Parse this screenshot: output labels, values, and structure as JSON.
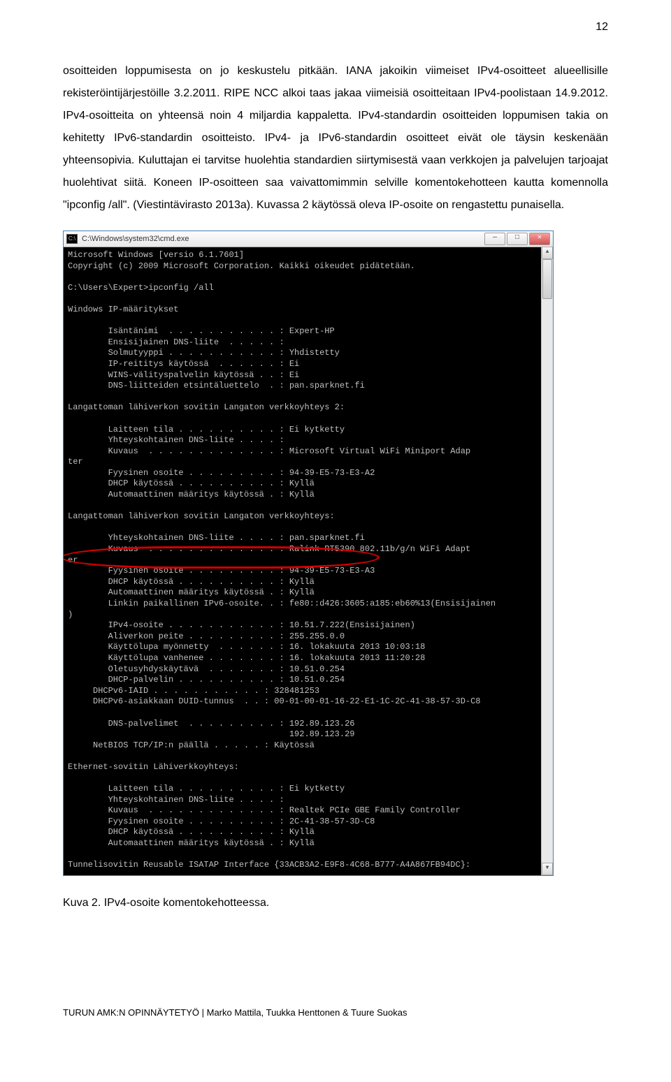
{
  "page_number": "12",
  "paragraph": "osoitteiden loppumisesta on jo keskustelu pitkään. IANA jakoikin viimeiset IPv4-osoitteet alueellisille rekisteröintijärjestöille 3.2.2011. RIPE NCC alkoi taas jakaa viimeisiä osoitteitaan IPv4-poolistaan 14.9.2012. IPv4-osoitteita on yhteensä noin 4 miljardia kappaletta. IPv4-standardin osoitteiden loppumisen takia on kehitetty IPv6-standardin osoitteisto. IPv4- ja IPv6-standardin osoitteet eivät ole täysin keskenään yhteensopivia. Kuluttajan ei tarvitse huolehtia standardien siirtymisestä vaan verkkojen ja palvelujen tarjoajat huolehtivat siitä. Koneen IP-osoitteen saa vaivattomimmin selville komentokehotteen kautta komennolla \"ipconfig /all\". (Viestintävirasto 2013a). Kuvassa 2 käytössä oleva IP-osoite on rengastettu punaisella.",
  "cmd": {
    "title": "C:\\Windows\\system32\\cmd.exe",
    "header1": "Microsoft Windows [versio 6.1.7601]",
    "header2": "Copyright (c) 2009 Microsoft Corporation. Kaikki oikeudet pidätetään.",
    "prompt": "C:\\Users\\Expert>ipconfig /all",
    "section_ip": "Windows IP-määritykset",
    "host_label": "        Isäntänimi  . . . . . . . . . . . : ",
    "host_val": "Expert-HP",
    "dns1_label": "        Ensisijainen DNS-liite  . . . . . :",
    "nodetype_label": "        Solmutyyppi . . . . . . . . . . . : ",
    "nodetype_val": "Yhdistetty",
    "iprouting_label": "        IP-reititys käytössä  . . . . . . : ",
    "iprouting_val": "Ei",
    "wins_label": "        WINS-välityspalvelin käytössä . . : ",
    "wins_val": "Ei",
    "dnssuffix_label": "        DNS-liitteiden etsintäluettelo  . : ",
    "dnssuffix_val": "pan.sparknet.fi",
    "adapter2_title": "Langattoman lähiverkon sovitin Langaton verkkoyhteys 2:",
    "a2_state_label": "        Laitteen tila . . . . . . . . . . : ",
    "a2_state_val": "Ei kytketty",
    "a2_dns_label": "        Yhteyskohtainen DNS-liite . . . . :",
    "a2_desc_label": "        Kuvaus  . . . . . . . . . . . . . : ",
    "a2_desc_val": "Microsoft Virtual WiFi Miniport Adap",
    "a2_cont": "ter",
    "a2_mac_label": "        Fyysinen osoite . . . . . . . . . : ",
    "a2_mac_val": "94-39-E5-73-E3-A2",
    "a2_dhcp_label": "        DHCP käytössä . . . . . . . . . . : ",
    "a2_dhcp_val": "Kyllä",
    "a2_auto_label": "        Automaattinen määritys käytössä . : ",
    "a2_auto_val": "Kyllä",
    "adapter1_title": "Langattoman lähiverkon sovitin Langaton verkkoyhteys:",
    "a1_dns_label": "        Yhteyskohtainen DNS-liite . . . . : ",
    "a1_dns_val": "pan.sparknet.fi",
    "a1_desc_label": "        Kuvaus  . . . . . . . . . . . . . : ",
    "a1_desc_val": "Ralink RT5390 802.11b/g/n WiFi Adapt",
    "a1_cont": "er",
    "a1_mac_label": "        Fyysinen osoite . . . . . . . . . : ",
    "a1_mac_val": "94-39-E5-73-E3-A3",
    "a1_dhcp_label": "        DHCP käytössä . . . . . . . . . . : ",
    "a1_dhcp_val": "Kyllä",
    "a1_auto_label": "        Automaattinen määritys käytössä . : ",
    "a1_auto_val": "Kyllä",
    "a1_ll_label": "        Linkin paikallinen IPv6-osoite. . : ",
    "a1_ll_val": "fe80::d426:3605:a185:eb60%13(Ensisijainen",
    "a1_ll_cont": ")",
    "a1_ipv4_label": "        IPv4-osoite . . . . . . . . . . . : ",
    "a1_ipv4_val": "10.51.7.222(Ensisijainen)",
    "a1_mask_label": "        Aliverkon peite . . . . . . . . . : ",
    "a1_mask_val": "255.255.0.0",
    "a1_lease1_label": "        Käyttölupa myönnetty  . . . . . . : ",
    "a1_lease1_val": "16. lokakuuta 2013 10:03:18",
    "a1_lease2_label": "        Käyttölupa vanhenee . . . . . . . : ",
    "a1_lease2_val": "16. lokakuuta 2013 11:20:28",
    "a1_gw_label": "        Oletusyhdyskäytävä  . . . . . . . : ",
    "a1_gw_val": "10.51.0.254",
    "a1_dhcps_label": "        DHCP-palvelin . . . . . . . . . . : ",
    "a1_dhcps_val": "10.51.0.254",
    "a1_iaid_label": "     DHCPv6-IAID . . . . . . . . . . . : ",
    "a1_iaid_val": "328481253",
    "a1_duid_label": "     DHCPv6-asiakkaan DUID-tunnus  . . : ",
    "a1_duid_val": "00-01-00-01-16-22-E1-1C-2C-41-38-57-3D-C8",
    "a1_dnss_label": "        DNS-palvelimet  . . . . . . . . . : ",
    "a1_dnss_val": "192.89.123.26",
    "a1_dnss_val2": "                                            192.89.123.29",
    "a1_nb_label": "     NetBIOS TCP/IP:n päällä . . . . . : ",
    "a1_nb_val": "Käytössä",
    "eth_title": "Ethernet-sovitin Lähiverkkoyhteys:",
    "e_state_label": "        Laitteen tila . . . . . . . . . . : ",
    "e_state_val": "Ei kytketty",
    "e_dns_label": "        Yhteyskohtainen DNS-liite . . . . :",
    "e_desc_label": "        Kuvaus  . . . . . . . . . . . . . : ",
    "e_desc_val": "Realtek PCIe GBE Family Controller",
    "e_mac_label": "        Fyysinen osoite . . . . . . . . . : ",
    "e_mac_val": "2C-41-38-57-3D-C8",
    "e_dhcp_label": "        DHCP käytössä . . . . . . . . . . : ",
    "e_dhcp_val": "Kyllä",
    "e_auto_label": "        Automaattinen määritys käytössä . : ",
    "e_auto_val": "Kyllä",
    "tunnel_title": "Tunnelisovitin Reusable ISATAP Interface {33ACB3A2-E9F8-4C68-B777-A4A867FB94DC}:"
  },
  "caption": "Kuva 2. IPv4-osoite komentokehotteessa.",
  "footer": "TURUN AMK:N OPINNÄYTETYÖ | Marko Mattila, Tuukka Henttonen & Tuure Suokas"
}
